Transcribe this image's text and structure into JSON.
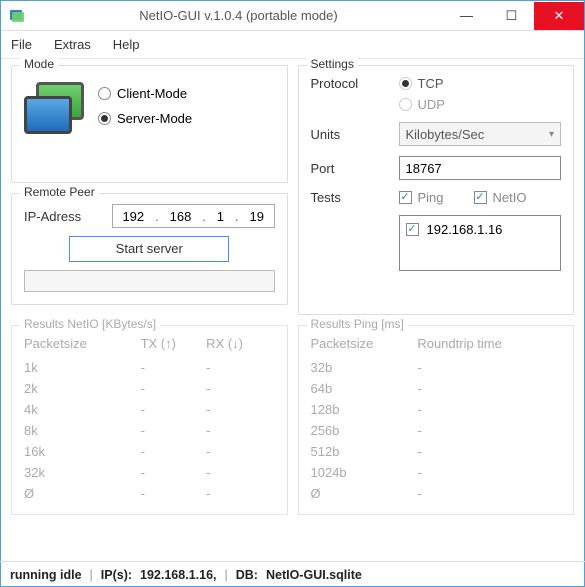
{
  "window": {
    "title": "NetIO-GUI v.1.0.4 (portable mode)"
  },
  "menu": {
    "file": "File",
    "extras": "Extras",
    "help": "Help"
  },
  "mode": {
    "title": "Mode",
    "client": "Client-Mode",
    "server": "Server-Mode",
    "selected": "server"
  },
  "remote_peer": {
    "title": "Remote Peer",
    "ip_label": "IP-Adress",
    "ip": {
      "a": "192",
      "b": "168",
      "c": "1",
      "d": "19"
    },
    "start_button": "Start server"
  },
  "settings": {
    "title": "Settings",
    "protocol_label": "Protocol",
    "tcp": "TCP",
    "udp": "UDP",
    "protocol_selected": "tcp",
    "units_label": "Units",
    "units_value": "Kilobytes/Sec",
    "port_label": "Port",
    "port_value": "18767",
    "tests_label": "Tests",
    "ping": "Ping",
    "netio": "NetIO",
    "ping_checked": true,
    "netio_checked": true,
    "peer_list": [
      "192.168.1.16"
    ]
  },
  "results_netio": {
    "title": "Results NetIO [KBytes/s]",
    "cols": {
      "packetsize": "Packetsize",
      "tx": "TX (↑)",
      "rx": "RX (↓)"
    },
    "rows": [
      {
        "ps": "1k",
        "tx": "-",
        "rx": "-"
      },
      {
        "ps": "2k",
        "tx": "-",
        "rx": "-"
      },
      {
        "ps": "4k",
        "tx": "-",
        "rx": "-"
      },
      {
        "ps": "8k",
        "tx": "-",
        "rx": "-"
      },
      {
        "ps": "16k",
        "tx": "-",
        "rx": "-"
      },
      {
        "ps": "32k",
        "tx": "-",
        "rx": "-"
      },
      {
        "ps": "Ø",
        "tx": "-",
        "rx": "-"
      }
    ]
  },
  "results_ping": {
    "title": "Results Ping [ms]",
    "cols": {
      "packetsize": "Packetsize",
      "rtt": "Roundtrip time"
    },
    "rows": [
      {
        "ps": "32b",
        "rtt": "-"
      },
      {
        "ps": "64b",
        "rtt": "-"
      },
      {
        "ps": "128b",
        "rtt": "-"
      },
      {
        "ps": "256b",
        "rtt": "-"
      },
      {
        "ps": "512b",
        "rtt": "-"
      },
      {
        "ps": "1024b",
        "rtt": "-"
      },
      {
        "ps": "Ø",
        "rtt": "-"
      }
    ]
  },
  "status": {
    "state": "running idle",
    "ips_label": "IP(s):",
    "ips": "192.168.1.16,",
    "db_label": "DB:",
    "db": "NetIO-GUI.sqlite"
  }
}
